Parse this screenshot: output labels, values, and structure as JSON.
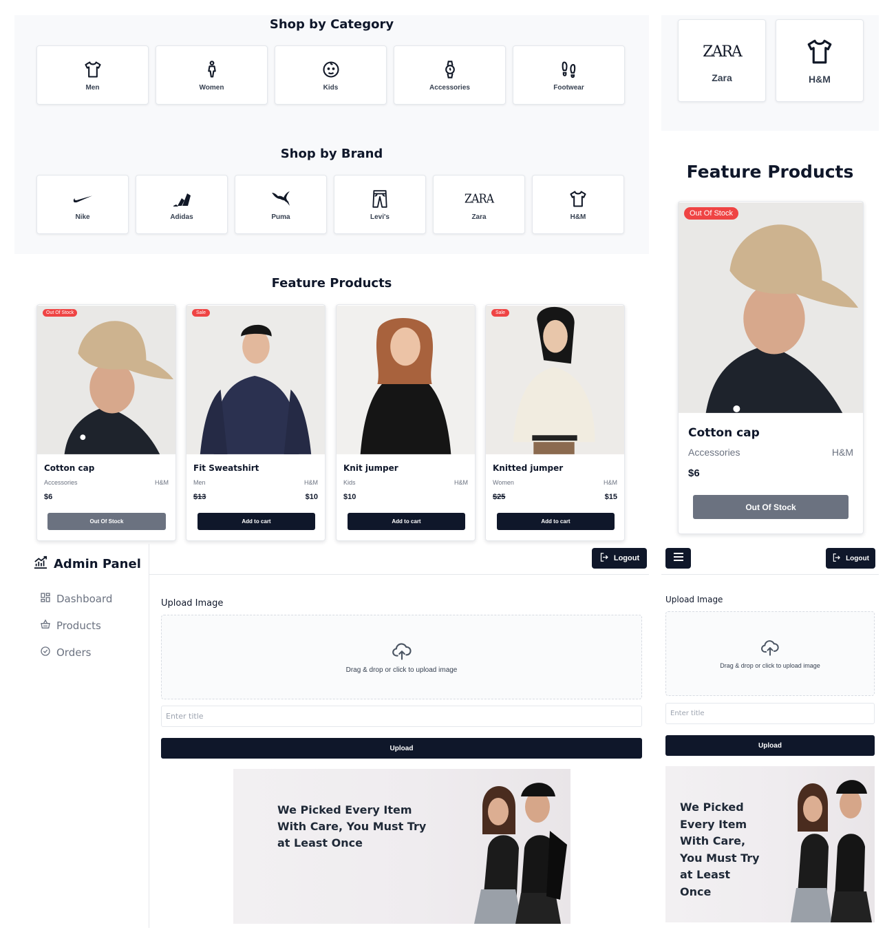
{
  "shop_category": {
    "title": "Shop by Category",
    "items": [
      {
        "label": "Men",
        "icon": "tshirt-icon"
      },
      {
        "label": "Women",
        "icon": "woman-icon"
      },
      {
        "label": "Kids",
        "icon": "baby-face-icon"
      },
      {
        "label": "Accessories",
        "icon": "watch-icon"
      },
      {
        "label": "Footwear",
        "icon": "footprints-icon"
      }
    ]
  },
  "shop_brand": {
    "title": "Shop by Brand",
    "items": [
      {
        "label": "Nike",
        "icon": "nike-swoosh-icon"
      },
      {
        "label": "Adidas",
        "icon": "adidas-logo-icon"
      },
      {
        "label": "Puma",
        "icon": "puma-logo-icon"
      },
      {
        "label": "Levi's",
        "icon": "jeans-icon"
      },
      {
        "label": "Zara",
        "icon": "zara-logo-icon",
        "logo_text": "ZARA"
      },
      {
        "label": "H&M",
        "icon": "tshirt-icon"
      }
    ]
  },
  "brand_preview": {
    "items": [
      {
        "label": "Zara",
        "logo_text": "ZARA"
      },
      {
        "label": "H&M"
      }
    ]
  },
  "featured": {
    "title": "Feature Products",
    "products": [
      {
        "badge": "Out Of Stock",
        "name": "Cotton cap",
        "category": "Accessories",
        "brand": "H&M",
        "price": "$6",
        "sale_price": "",
        "button": "Out Of Stock",
        "available": false
      },
      {
        "badge": "Sale",
        "name": "Fit Sweatshirt",
        "category": "Men",
        "brand": "H&M",
        "price": "$13",
        "sale_price": "$10",
        "button": "Add to cart",
        "available": true
      },
      {
        "badge": "",
        "name": "Knit jumper",
        "category": "Kids",
        "brand": "H&M",
        "price": "$10",
        "sale_price": "",
        "button": "Add to cart",
        "available": true
      },
      {
        "badge": "Sale",
        "name": "Knitted jumper",
        "category": "Women",
        "brand": "H&M",
        "price": "$25",
        "sale_price": "$15",
        "button": "Add to cart",
        "available": true
      }
    ]
  },
  "featured_mobile": {
    "title": "Feature Products",
    "product": {
      "badge": "Out Of Stock",
      "name": "Cotton cap",
      "category": "Accessories",
      "brand": "H&M",
      "price": "$6",
      "button": "Out Of Stock"
    }
  },
  "admin": {
    "title": "Admin Panel",
    "logout": "Logout",
    "nav": [
      {
        "label": "Dashboard",
        "icon": "dashboard-icon"
      },
      {
        "label": "Products",
        "icon": "basket-icon"
      },
      {
        "label": "Orders",
        "icon": "check-circle-icon"
      }
    ],
    "upload_label": "Upload Image",
    "dropzone_text": "Drag & drop or click to upload image",
    "title_placeholder": "Enter title",
    "upload_button": "Upload",
    "banner_headline": "We Picked Every Item With Care, You Must Try at Least Once"
  },
  "admin_mobile": {
    "logout": "Logout",
    "upload_label": "Upload Image",
    "dropzone_text": "Drag & drop or click to upload image",
    "title_placeholder": "Enter title",
    "upload_button": "Upload",
    "banner_headline": "We Picked Every Item With Care, You Must Try at Least Once"
  },
  "colors": {
    "accent": "#0f172a",
    "sale_badge": "#ef4444",
    "disabled": "#6b7280",
    "section_bg": "#f8f9fb"
  }
}
